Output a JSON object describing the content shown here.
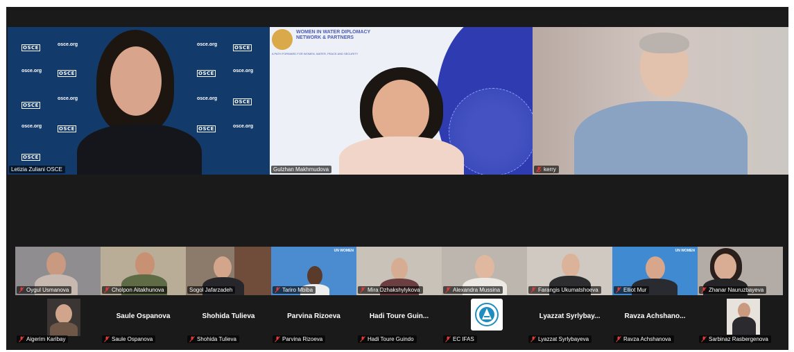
{
  "main_participants": [
    {
      "name": "Letizia Zuliani OSCE",
      "backdrop_logo": "OSCE",
      "backdrop_url": "osce.org"
    },
    {
      "name": "Gulzhan Makhmudova",
      "banner_title": "WOMEN IN WATER DIPLOMACY NETWORK & PARTNERS",
      "banner_subtitle": "A PATH FORWARD FOR WOMEN, WATER, PEACE AND SECURITY"
    },
    {
      "name": "kerry"
    }
  ],
  "gallery_row1": [
    {
      "name": "Oygul Usmanova"
    },
    {
      "name": "Cholpon Aitakhunova"
    },
    {
      "name": "Sogol Jafarzadeh"
    },
    {
      "name": "Tariro Mbiba"
    },
    {
      "name": "Mira Dzhakshylykova"
    },
    {
      "name": "Alexandra Mussina"
    },
    {
      "name": "Farangis Ukumatshoeva"
    },
    {
      "name": "Elliot Mur"
    },
    {
      "name": "Zhanar Nauruzbayeva"
    }
  ],
  "gallery_row2": [
    {
      "name": "Aigerim Karibay",
      "display": ""
    },
    {
      "name": "Saule Ospanova",
      "display": "Saule Ospanova"
    },
    {
      "name": "Shohida Tulieva",
      "display": "Shohida Tulieva"
    },
    {
      "name": "Parvina Rizoeva",
      "display": "Parvina Rizoeva"
    },
    {
      "name": "Hadi Toure Guindo",
      "display": "Hadi Toure Guin..."
    },
    {
      "name": "EC IFAS",
      "display": ""
    },
    {
      "name": "Lyazzat Syrlybayeva",
      "display": "Lyazzat Syrlybay..."
    },
    {
      "name": "Ravza Achshanova",
      "display": "Ravza Achshano..."
    },
    {
      "name": "Sarbinaz Rasbergenova",
      "display": ""
    }
  ],
  "un_badge": "UN WOMEN",
  "colors": {
    "speaker_outline": "#2bd46a",
    "osce_blue": "#123a6b",
    "mic_muted": "#e03b3b"
  }
}
